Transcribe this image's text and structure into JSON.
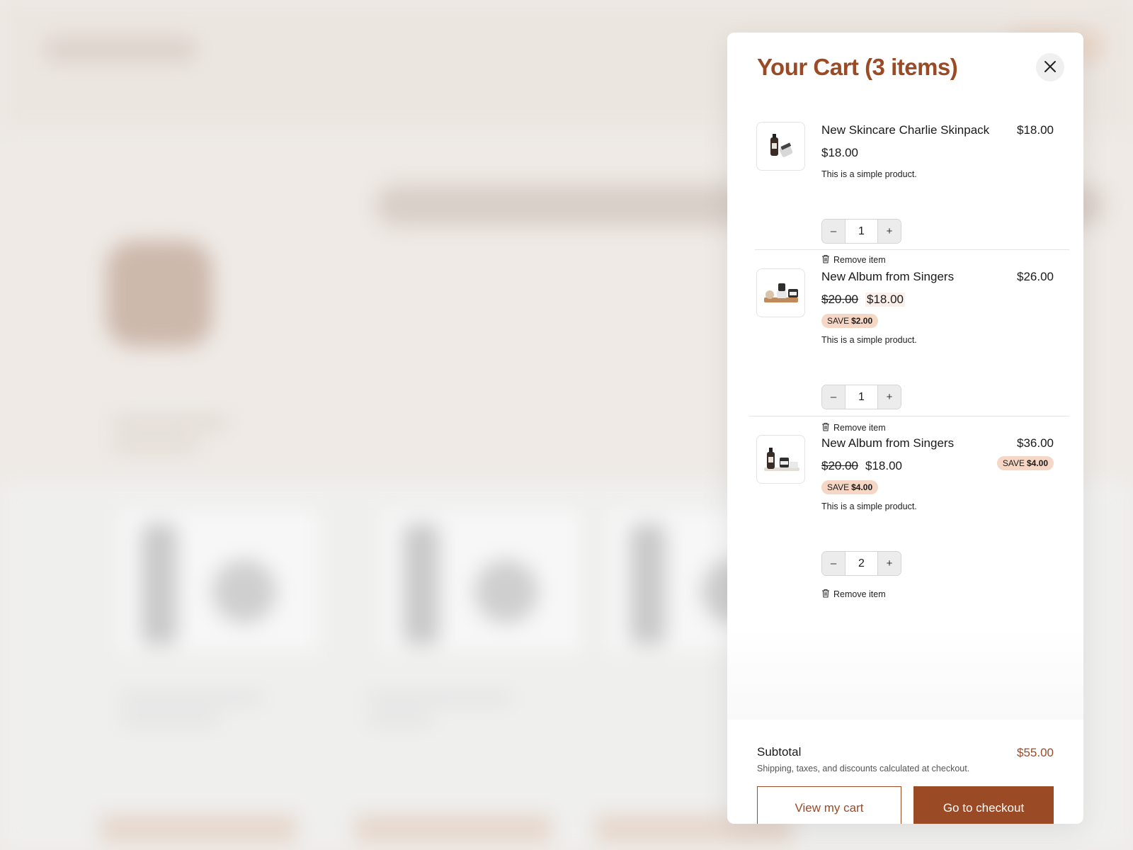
{
  "cart": {
    "title": "Your Cart (3 items)",
    "close_icon": "close-icon",
    "items": [
      {
        "name": "New Skincare Charlie Skinpack",
        "line_total": "$18.00",
        "price": "$18.00",
        "description": "This is a simple product.",
        "quantity": "1",
        "remove_label": "Remove item",
        "thumb_icon": "product-image"
      },
      {
        "name": "New Album from Singers",
        "line_total": "$26.00",
        "price_old": "$20.00",
        "price_new": "$18.00",
        "save_label": "SAVE",
        "save_amount": "$2.00",
        "description": "This is a simple product.",
        "quantity": "1",
        "remove_label": "Remove item",
        "thumb_icon": "product-image"
      },
      {
        "name": "New Album from Singers",
        "line_total": "$36.00",
        "line_save_label": "SAVE",
        "line_save_amount": "$4.00",
        "price_old": "$20.00",
        "price_new": "$18.00",
        "save_label": "SAVE",
        "save_amount": "$4.00",
        "description": "This is a simple product.",
        "quantity": "2",
        "remove_label": "Remove item",
        "thumb_icon": "product-image"
      }
    ],
    "stepper": {
      "minus": "–",
      "plus": "+"
    },
    "footer": {
      "subtotal_label": "Subtotal",
      "subtotal_value": "$55.00",
      "note": "Shipping, taxes, and discounts calculated at checkout.",
      "view_cart": "View my cart",
      "checkout": "Go to checkout"
    }
  },
  "colors": {
    "accent": "#9a4b26",
    "badge": "#f6d6c5",
    "backdrop": "#efeae6"
  }
}
